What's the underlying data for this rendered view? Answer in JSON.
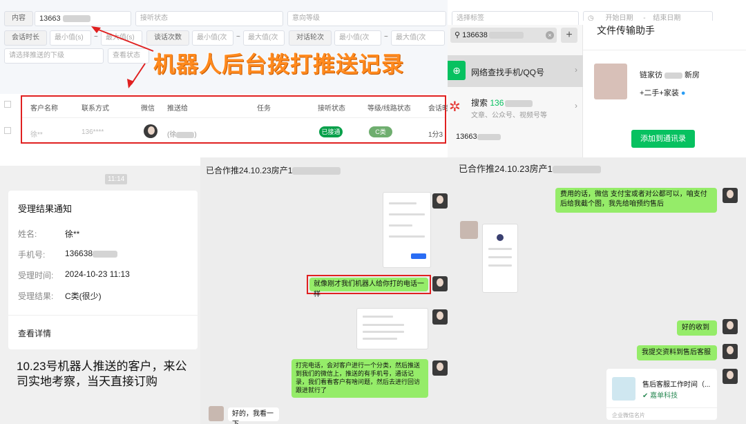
{
  "admin": {
    "filters_row1": {
      "content_label": "内容",
      "content_value": "13663",
      "listen_status": "接听状态",
      "intent_level": "意向等级",
      "intent_tag": "选择标签",
      "start_date": "开始日期",
      "date_sep": "-",
      "end_date": "结束日期"
    },
    "filters_row2": {
      "duration_label": "会话时长",
      "min1": "最小值(s)",
      "sep1": "~",
      "max1": "最大值(s)",
      "count_label": "谈话次数",
      "min2": "最小值(次",
      "sep2": "~",
      "max2": "最大值(次",
      "rounds_label": "对话轮次",
      "min3": "最小值(次",
      "sep3": "~",
      "max3": "最大值(次"
    },
    "filters_row3": {
      "push_placeholder": "请选择推送的下级",
      "view_status": "查看状态"
    },
    "banner": "机器人后台拨打推送记录",
    "table": {
      "headers": [
        "客户名称",
        "联系方式",
        "微信",
        "推送给",
        "任务",
        "接听状态",
        "等级/线路状态",
        "会话时"
      ],
      "row": {
        "customer": "徐**",
        "contact": "136****",
        "push_to": "(徐",
        "listen_status": "已接通",
        "level": "C类",
        "duration": "1分3"
      }
    }
  },
  "search_panel": {
    "query": "136638",
    "net_find": "网络查找手机/QQ号",
    "search_label": "搜索",
    "search_number": "136",
    "search_sub": "文章、公众号、视频号等",
    "result_number": "13663"
  },
  "file_helper": {
    "title": "文件传输助手",
    "name": "链家彷",
    "name_suffix": "新房",
    "tags": "+二手+家装",
    "add_button": "添加到通讯录"
  },
  "receipt": {
    "time": "11:14",
    "title": "受理结果通知",
    "name_label": "姓名:",
    "name_value": "徐**",
    "phone_label": "手机号:",
    "phone_value": "136638",
    "time_label": "受理时间:",
    "time_value": "2024-10-23 11:13",
    "result_label": "受理结果:",
    "result_value": "C类(很少)",
    "details": "查看详情",
    "caption": "10.23号机器人推送的客户，来公司实地考察，当天直接订购"
  },
  "chat1": {
    "title": "已合作推24.10.23房产1",
    "msg_robot": "就像刚才我们机器人给你打的电话一样",
    "msg_explain": "打完电话，会对客户进行一个分类，然后推送到我们的微信上，推送的有手机号，通话记录，我们看看客户有啥问题，然后去进行回访跟进就行了",
    "msg_reply": "好的，我看一下"
  },
  "chat2": {
    "title": "已合作推24.10.23房产1",
    "msg_fee": "费用的话，微信 支付宝或者对公都可以，咱支付后给我截个图，我先给咱预约售后",
    "msg_received": "好的收到",
    "msg_submit": "我提交资料到售后客服",
    "card_title": "售后客服工作时间（...",
    "card_company": "嘉单科技",
    "card_footer": "企业微信名片"
  },
  "colors": {
    "orange_banner": "#ff8a1e",
    "red_box": "#e02020",
    "wechat_green": "#07c160",
    "bubble_green": "#95ec69"
  }
}
